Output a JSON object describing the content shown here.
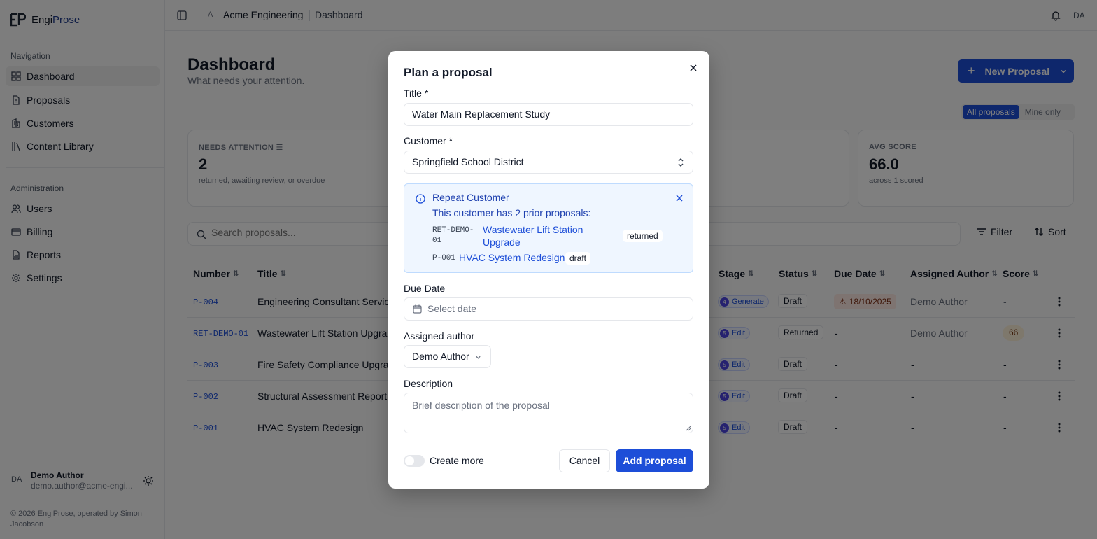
{
  "app": {
    "logo_part1": "Engi",
    "logo_part2": "Prose",
    "footer": "© 2026 EngiProse, operated by Simon Jacobson"
  },
  "sidebar": {
    "nav_heading": "Navigation",
    "nav_items": [
      {
        "label": "Dashboard",
        "icon": "layout-grid-icon"
      },
      {
        "label": "Proposals",
        "icon": "file-icon"
      },
      {
        "label": "Customers",
        "icon": "building-icon"
      },
      {
        "label": "Content Library",
        "icon": "library-icon"
      }
    ],
    "admin_heading": "Administration",
    "admin_items": [
      {
        "label": "Users",
        "icon": "users-icon"
      },
      {
        "label": "Billing",
        "icon": "credit-card-icon"
      },
      {
        "label": "Reports",
        "icon": "file-chart-icon"
      },
      {
        "label": "Settings",
        "icon": "gear-icon"
      }
    ],
    "user": {
      "initials": "DA",
      "name": "Demo Author",
      "email": "demo.author@acme-engi..."
    }
  },
  "topbar": {
    "org_initial": "A",
    "org_name": "Acme Engineering",
    "page": "Dashboard",
    "user_initials": "DA"
  },
  "main": {
    "title": "Dashboard",
    "subtitle": "What needs your attention.",
    "new_button": "New Proposal",
    "filter_segments": [
      "All proposals",
      "Mine only"
    ],
    "stats": [
      {
        "label": "NEEDS ATTENTION",
        "value": "2",
        "note": "returned, awaiting review, or overdue"
      },
      {
        "label": "AVG SCORE",
        "value": "66.0",
        "note": "across 1 scored"
      }
    ],
    "search_placeholder": "Search proposals...",
    "filter_label": "Filter",
    "sort_label": "Sort",
    "columns": [
      "Number",
      "Title",
      "Stage",
      "Status",
      "Due Date",
      "Assigned Author",
      "Score"
    ],
    "rows": [
      {
        "number": "P-004",
        "title": "Engineering Consultant Service",
        "stage_n": "4",
        "stage": "Generate",
        "status": "Draft",
        "due": "18/10/2025",
        "author": "Demo Author",
        "score": "-"
      },
      {
        "number": "RET-DEMO-01",
        "title": "Wastewater Lift Station Upgrad",
        "stage_n": "5",
        "stage": "Edit",
        "status": "Returned",
        "due": "-",
        "author": "Demo Author",
        "score": "66"
      },
      {
        "number": "P-003",
        "title": "Fire Safety Compliance Upgrad",
        "stage_n": "5",
        "stage": "Edit",
        "status": "Draft",
        "due": "-",
        "author": "-",
        "score": "-"
      },
      {
        "number": "P-002",
        "title": "Structural Assessment Report",
        "stage_n": "5",
        "stage": "Edit",
        "status": "Draft",
        "due": "-",
        "author": "-",
        "score": "-"
      },
      {
        "number": "P-001",
        "title": "HVAC System Redesign",
        "stage_n": "5",
        "stage": "Edit",
        "status": "Draft",
        "due": "-",
        "author": "-",
        "score": "-"
      }
    ]
  },
  "modal": {
    "title": "Plan a proposal",
    "title_label": "Title *",
    "title_value": "Water Main Replacement Study",
    "customer_label": "Customer *",
    "customer_value": "Springfield School District",
    "repeat": {
      "title": "Repeat Customer",
      "subtitle": "This customer has 2 prior proposals:",
      "items": [
        {
          "code": "RET-DEMO-01",
          "code_line1": "RET-DEMO-",
          "code_line2": "01",
          "title": "Wastewater Lift Station Upgrade",
          "title_line1": "Wastewater Lift Station",
          "title_line2": "Upgrade",
          "status": "returned"
        },
        {
          "code": "P-001",
          "title": "HVAC System Redesign",
          "status": "draft"
        }
      ]
    },
    "due_label": "Due Date",
    "due_placeholder": "Select date",
    "author_label": "Assigned author",
    "author_value": "Demo Author",
    "description_label": "Description",
    "description_placeholder": "Brief description of the proposal",
    "create_more_label": "Create more",
    "create_more_on": false,
    "cancel_label": "Cancel",
    "submit_label": "Add proposal"
  },
  "colors": {
    "primary": "#1d4ed8",
    "info_bg": "#eff6ff",
    "warning_bg": "#fde8e3",
    "score_bg": "#fdf0d8"
  }
}
